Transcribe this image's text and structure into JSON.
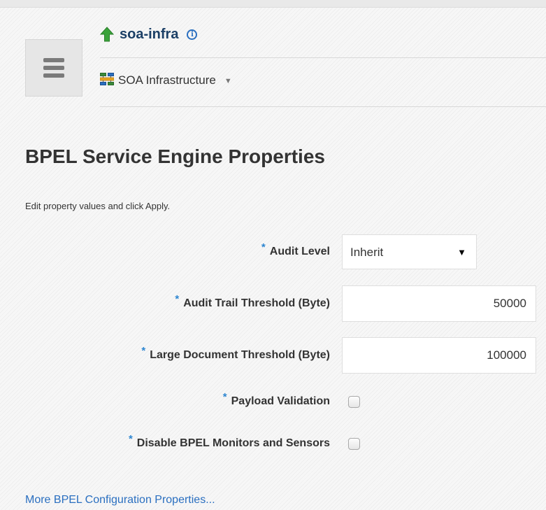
{
  "header": {
    "target_name": "soa-infra",
    "target_menu_label": "SOA Infrastructure"
  },
  "page": {
    "title": "BPEL Service Engine Properties",
    "instructions": "Edit property values and click Apply."
  },
  "form": {
    "required_marker": "*",
    "audit_level": {
      "label": "Audit Level",
      "value": "Inherit"
    },
    "audit_trail_threshold": {
      "label": "Audit Trail Threshold (Byte)",
      "value": "50000"
    },
    "large_document_threshold": {
      "label": "Large Document Threshold (Byte)",
      "value": "100000"
    },
    "payload_validation": {
      "label": "Payload Validation",
      "checked": false
    },
    "disable_monitors": {
      "label": "Disable BPEL Monitors and Sensors",
      "checked": false
    }
  },
  "links": {
    "more_config": "More BPEL Configuration Properties..."
  },
  "icons": {
    "menu": "hamburger-menu-icon",
    "up": "up-arrow-icon",
    "info": "info-icon",
    "target": "soa-infrastructure-icon",
    "dropdown": "chevron-down-icon"
  },
  "colors": {
    "title_blue": "#1b3f66",
    "link_blue": "#2a6fc0",
    "required_blue": "#2d86d1",
    "up_arrow_green": "#3aa23a"
  }
}
